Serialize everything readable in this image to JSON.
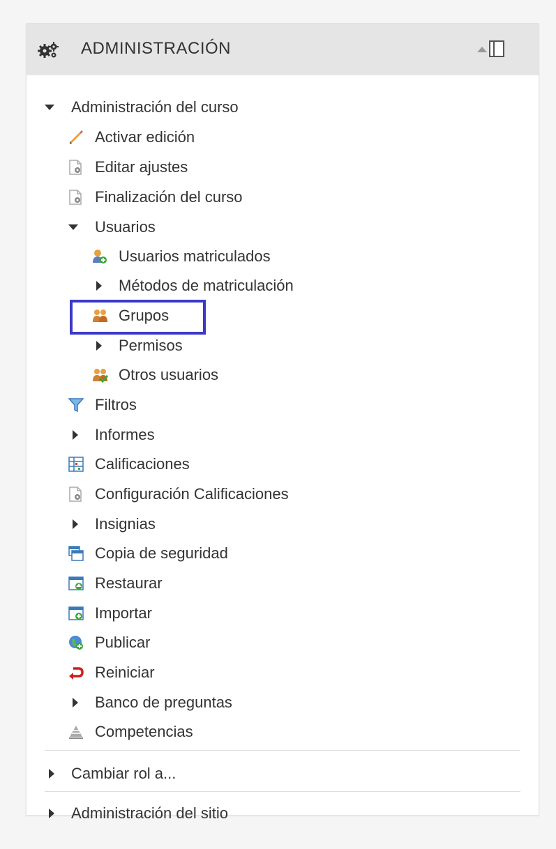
{
  "block": {
    "title": "ADMINISTRACIÓN",
    "icons": {
      "header": "gears-icon",
      "collapse": "triangle-up-icon",
      "dock": "dock-icon"
    }
  },
  "tree": {
    "course_admin": "Administración del curso",
    "activate_editing": "Activar edición",
    "edit_settings": "Editar ajustes",
    "course_completion": "Finalización del curso",
    "users": "Usuarios",
    "enrolled_users": "Usuarios matriculados",
    "enrolment_methods": "Métodos de matriculación",
    "groups": "Grupos",
    "permissions": "Permisos",
    "other_users": "Otros usuarios",
    "filters": "Filtros",
    "reports": "Informes",
    "grades": "Calificaciones",
    "grade_setup": "Configuración Calificaciones",
    "badges": "Insignias",
    "backup": "Copia de seguridad",
    "restore": "Restaurar",
    "import": "Importar",
    "publish": "Publicar",
    "reset": "Reiniciar",
    "question_bank": "Banco de preguntas",
    "competencies": "Competencias",
    "switch_role": "Cambiar rol a...",
    "site_admin": "Administración del sitio"
  },
  "colors": {
    "highlight_border": "#3a3ac8",
    "header_bg": "#e5e5e5"
  }
}
